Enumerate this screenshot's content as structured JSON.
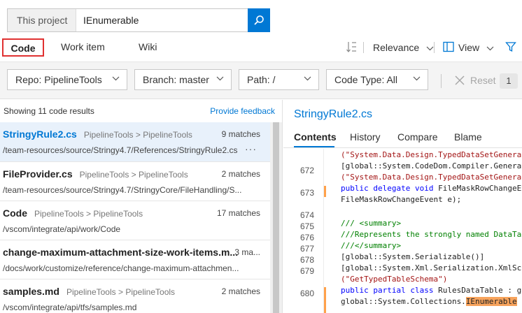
{
  "search": {
    "scope": "This project",
    "query": "IEnumerable"
  },
  "tabs": [
    {
      "label": "Code"
    },
    {
      "label": "Work item"
    },
    {
      "label": "Wiki"
    }
  ],
  "sort": {
    "label": "Relevance"
  },
  "view": {
    "label": "View"
  },
  "filters": {
    "repo": "Repo: PipelineTools",
    "branch": "Branch: master",
    "path": "Path: /",
    "code_type": "Code Type: All",
    "reset": "Reset",
    "count": "1"
  },
  "results_header": {
    "summary": "Showing 11 code results",
    "feedback": "Provide feedback"
  },
  "results": [
    {
      "file": "StringyRule2.cs",
      "repo": "PipelineTools > PipelineTools",
      "matches": "9 matches",
      "path": "/team-resources/source/Stringy4.7/References/StringyRule2.cs",
      "more": "···"
    },
    {
      "file": "FileProvider.cs",
      "repo": "PipelineTools > PipelineTools",
      "matches": "2 matches",
      "path": "/team-resources/source/Stringy4.7/StringyCore/FileHandling/S..."
    },
    {
      "file": "Code",
      "repo": "PipelineTools > PipelineTools",
      "matches": "17 matches",
      "path": "/vscom/integrate/api/work/Code"
    },
    {
      "file": "change-maximum-attachment-size-work-items.m...",
      "repo": "",
      "matches": "3 ma...",
      "path": "/docs/work/customize/reference/change-maximum-attachmen..."
    },
    {
      "file": "samples.md",
      "repo": "PipelineTools > PipelineTools",
      "matches": "2 matches",
      "path": "/vscom/integrate/api/tfs/samples.md"
    }
  ],
  "preview": {
    "title": "StringyRule2.cs",
    "tabs": [
      "Contents",
      "History",
      "Compare",
      "Blame"
    ],
    "line_numbers": [
      "672",
      "673",
      "674",
      "675",
      "676",
      "677",
      "678",
      "679",
      "680"
    ],
    "code": {
      "l0": "(\"System.Data.Design.TypedDataSetGenerat",
      "l1": "[global::System.CodeDom.Compiler.Generat",
      "l2": "(\"System.Data.Design.TypedDataSetGenerat",
      "l3a": "public delegate void",
      "l3b": " FileMaskRowChangeEv",
      "l4": "FileMaskRowChangeEvent e);",
      "l6": "/// <summary>",
      "l7": "///Represents the strongly named DataTab",
      "l8": "///</summary>",
      "l9": "[global::System.Serializable()]",
      "l10": "[global::System.Xml.Serialization.XmlSch",
      "l11": "(\"GetTypedTableSchema\")",
      "l12a": "public partial class",
      "l12b": " RulesDataTable : g",
      "l13a": "global::System.Collections.",
      "l13b": "IEnumerable"
    }
  },
  "colors": {
    "accent": "#0078d4",
    "tab_highlight": "#e03131",
    "match_highlight": "#f7a35c"
  }
}
